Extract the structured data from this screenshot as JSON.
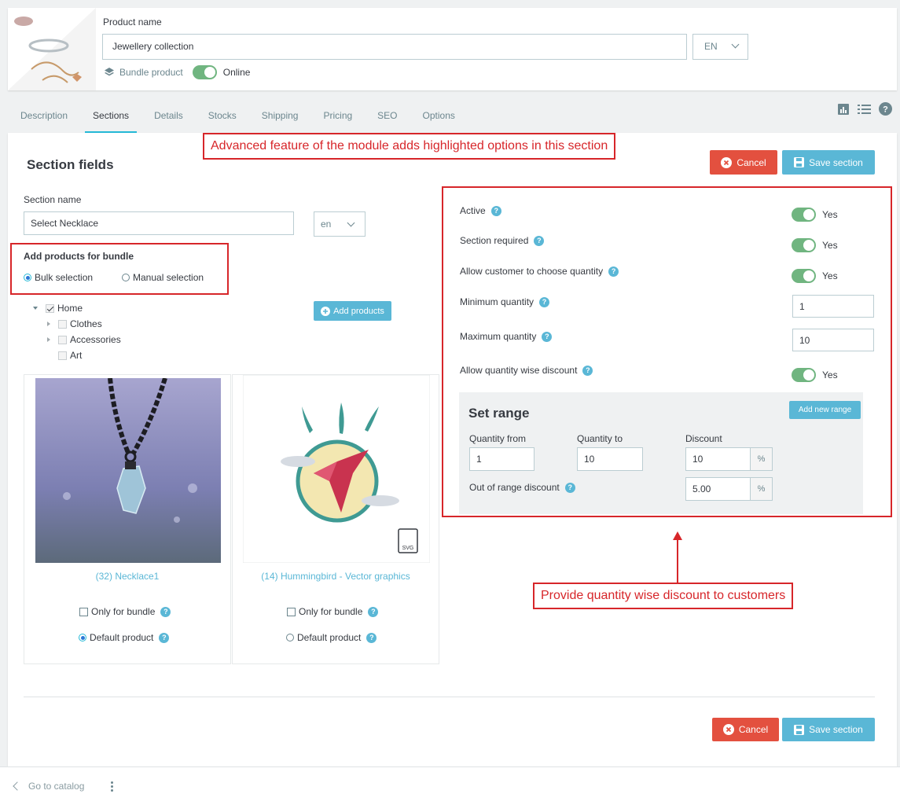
{
  "header": {
    "product_name_label": "Product name",
    "product_name_value": "Jewellery collection",
    "language": "EN",
    "product_type": "Bundle product",
    "online_label": "Online"
  },
  "tabs": [
    {
      "label": "Description"
    },
    {
      "label": "Sections"
    },
    {
      "label": "Details"
    },
    {
      "label": "Stocks"
    },
    {
      "label": "Shipping"
    },
    {
      "label": "Pricing"
    },
    {
      "label": "SEO"
    },
    {
      "label": "Options"
    }
  ],
  "section": {
    "title": "Section fields",
    "cancel_label": "Cancel",
    "save_label": "Save section",
    "name_label": "Section name",
    "name_value": "Select Necklace",
    "name_lang": "en",
    "add_products_title": "Add products for bundle",
    "bulk_label": "Bulk selection",
    "manual_label": "Manual selection",
    "add_products_button": "Add products",
    "tree": [
      "Home",
      "Clothes",
      "Accessories",
      "Art"
    ]
  },
  "annotations": {
    "top": "Advanced feature of the module adds highlighted options in this section",
    "bottom": "Provide quantity wise discount to customers"
  },
  "products": [
    {
      "name": "(32) Necklace1",
      "only_bundle": "Only for bundle",
      "default": "Default product",
      "default_selected": true
    },
    {
      "name": "(14) Hummingbird - Vector graphics",
      "only_bundle": "Only for bundle",
      "default": "Default product",
      "default_selected": false
    }
  ],
  "settings": {
    "active_label": "Active",
    "required_label": "Section required",
    "choose_qty_label": "Allow customer to choose quantity",
    "min_qty_label": "Minimum quantity",
    "min_qty_value": "1",
    "max_qty_label": "Maximum quantity",
    "max_qty_value": "10",
    "qty_discount_label": "Allow quantity wise discount",
    "yes": "Yes"
  },
  "range": {
    "title": "Set range",
    "add_button": "Add new range",
    "from_label": "Quantity from",
    "to_label": "Quantity to",
    "discount_label": "Discount",
    "from_value": "1",
    "to_value": "10",
    "discount_value": "10",
    "percent": "%",
    "out_of_range_label": "Out of range discount",
    "out_of_range_value": "5.00"
  },
  "footer": {
    "go_to_catalog": "Go to catalog"
  },
  "colors": {
    "accent": "#25b9d7",
    "toggle_on": "#70b580",
    "cancel": "#e3503f",
    "save": "#5ab7d6",
    "annotation": "#d7262a"
  }
}
